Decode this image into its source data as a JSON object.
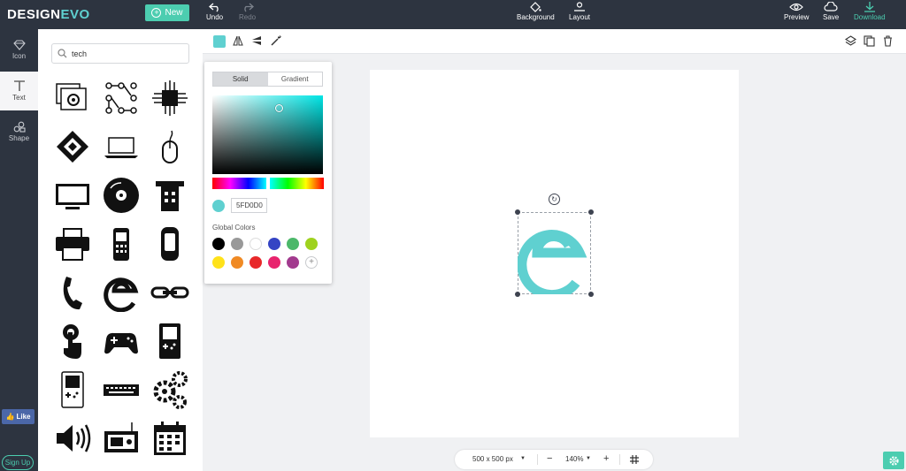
{
  "brand": {
    "logo_part1": "DESIGN",
    "logo_part2": "EVO",
    "accent": "#5fd0d0",
    "button_color": "#4ccdb0"
  },
  "topbar": {
    "new_label": "New",
    "undo_label": "Undo",
    "redo_label": "Redo",
    "background_label": "Background",
    "layout_label": "Layout",
    "preview_label": "Preview",
    "save_label": "Save",
    "download_label": "Download"
  },
  "leftnav": {
    "items": [
      {
        "label": "Icon",
        "icon": "diamond-icon"
      },
      {
        "label": "Text",
        "icon": "text-t-icon"
      },
      {
        "label": "Shape",
        "icon": "shapes-icon"
      }
    ],
    "like_label": "Like",
    "signup_label": "Sign Up"
  },
  "search": {
    "value": "tech",
    "placeholder": ""
  },
  "icon_results": [
    "folders-gear-icon",
    "circuit-dots-icon",
    "chip-icon",
    "diamond-arrows-icon",
    "laptop-icon",
    "mouse-icon",
    "monitor-icon",
    "vinyl-disc-icon",
    "cash-register-icon",
    "printer-icon",
    "feature-phone-icon",
    "flip-phone-icon",
    "telephone-handset-icon",
    "spiral-e-icon",
    "chain-link-icon",
    "touch-finger-icon",
    "gamepad-icon",
    "gameboy-icon",
    "gameboy-outline-icon",
    "keyboard-icon",
    "gears-icon",
    "speaker-icon",
    "radio-icon",
    "calendar-icon"
  ],
  "color_picker": {
    "tab_solid": "Solid",
    "tab_gradient": "Gradient",
    "hex_value": "5FD0D0",
    "current_color": "#5fd0d0",
    "global_colors_label": "Global Colors",
    "global_colors": [
      "#000000",
      "#999999",
      "#ffffff",
      "#3444c4",
      "#4cb86a",
      "#9fd21e",
      "#ffe21a",
      "#f08a24",
      "#e8282a",
      "#e8246e",
      "#a23a8e"
    ]
  },
  "canvas": {
    "size_label": "500 x 500 px",
    "zoom_label": "140%"
  }
}
